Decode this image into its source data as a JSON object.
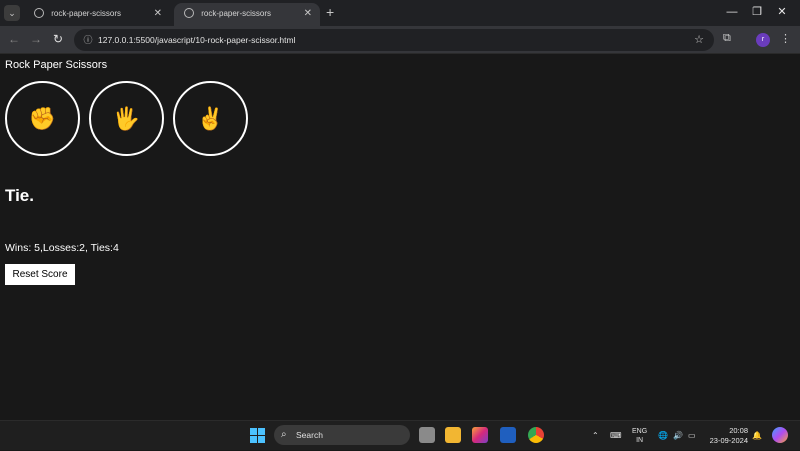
{
  "browser": {
    "tabs": [
      {
        "title": "rock-paper-scissors",
        "active": false
      },
      {
        "title": "rock-paper-scissors",
        "active": true
      }
    ],
    "new_tab_icon": "plus-icon",
    "url": "127.0.0.1:5500/javascript/10-rock-paper-scissor.html",
    "profile_initial": "r"
  },
  "page": {
    "title": "Rock Paper Scissors",
    "moves": [
      {
        "name": "rock",
        "glyph": "✊"
      },
      {
        "name": "paper",
        "glyph": "🖐"
      },
      {
        "name": "scissors",
        "glyph": "✌"
      }
    ],
    "result": "Tie.",
    "score_text": "Wins: 5,Losses:2, Ties:4",
    "reset_label": "Reset Score"
  },
  "taskbar": {
    "search_label": "Search",
    "lang_line1": "ENG",
    "lang_line2": "IN",
    "time": "20:08",
    "date": "23-09-2024"
  },
  "colors": {
    "page_bg": "#181818",
    "accent_profile": "#6a3cbc",
    "start_blue": "#4cc2ff"
  }
}
